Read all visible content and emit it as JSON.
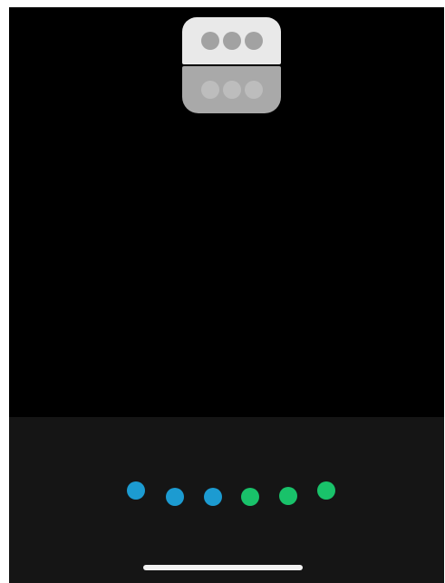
{
  "icons": {
    "pill_top": "more-dots-icon",
    "pill_bottom": "more-dots-icon"
  },
  "colors": {
    "screen_bg": "#000000",
    "dock_bg": "#151515",
    "pill_top_bg": "#e9e9e9",
    "pill_bottom_bg": "#a9a9a9",
    "blue_dot": "#1c9bd1",
    "green_dot": "#19c26a",
    "home_indicator": "#f2f2f2"
  },
  "dots": [
    {
      "color": "blue"
    },
    {
      "color": "blue"
    },
    {
      "color": "blue"
    },
    {
      "color": "green"
    },
    {
      "color": "green"
    },
    {
      "color": "green"
    }
  ]
}
